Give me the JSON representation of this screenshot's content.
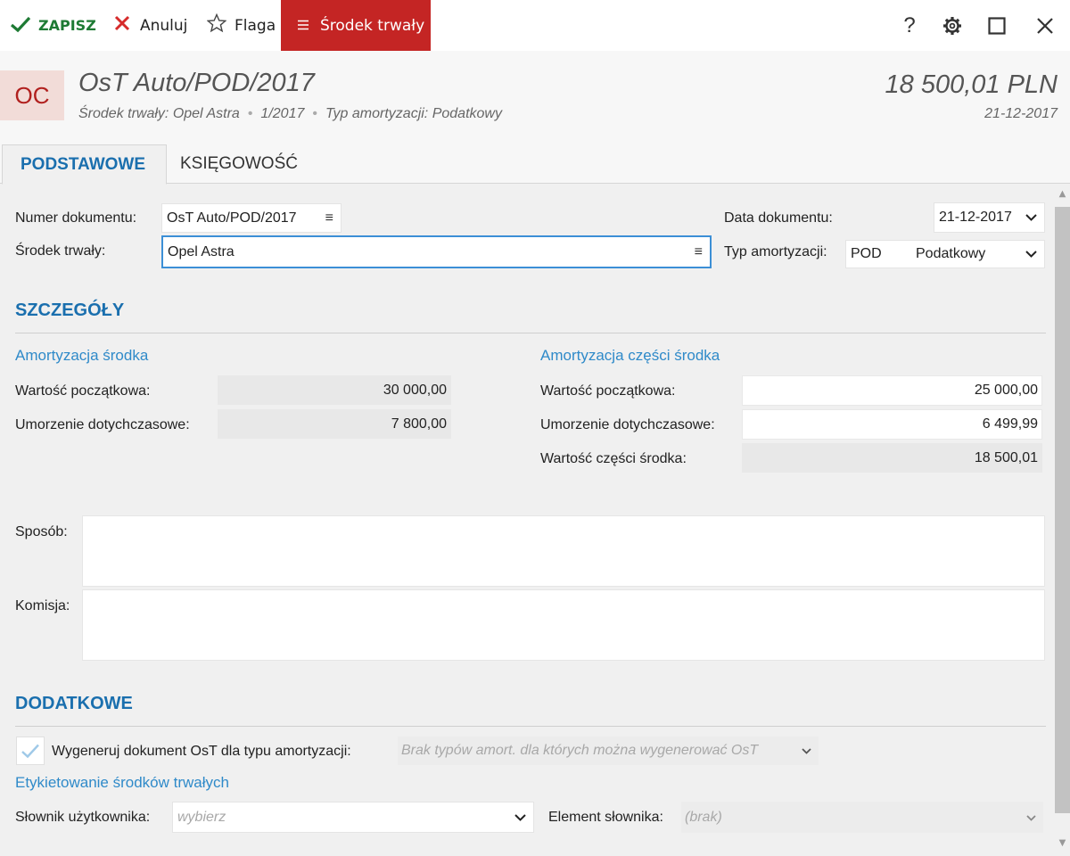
{
  "toolbar": {
    "save_label": "ZAPISZ",
    "cancel_label": "Anuluj",
    "flag_label": "Flaga",
    "asset_label": "Środek trwały",
    "help_label": "?",
    "colors": {
      "save": "#1e7a34",
      "cancel": "#d62b2b",
      "asset_bg": "#c42524"
    }
  },
  "header": {
    "badge": "OC",
    "title": "OsT Auto/POD/2017",
    "subtitle_asset": "Środek trwały: Opel Astra",
    "subtitle_number": "1/2017",
    "subtitle_type": "Typ amortyzacji: Podatkowy",
    "amount": "18 500,01 PLN",
    "date": "21-12-2017"
  },
  "tabs": [
    {
      "label": "PODSTAWOWE",
      "active": true
    },
    {
      "label": "KSIĘGOWOŚĆ",
      "active": false
    }
  ],
  "form": {
    "doc_number_label": "Numer dokumentu:",
    "doc_number_value": "OsT Auto/POD/2017",
    "asset_label": "Środek trwały:",
    "asset_value": "Opel Astra",
    "doc_date_label": "Data dokumentu:",
    "doc_date_value": "21-12-2017",
    "amort_type_label": "Typ amortyzacji:",
    "amort_type_code": "POD",
    "amort_type_name": "Podatkowy"
  },
  "details": {
    "section_title": "SZCZEGÓŁY",
    "left": {
      "heading": "Amortyzacja środka",
      "initial_label": "Wartość początkowa:",
      "initial_value": "30 000,00",
      "depr_label": "Umorzenie dotychczasowe:",
      "depr_value": "7 800,00"
    },
    "right": {
      "heading": "Amortyzacja części środka",
      "initial_label": "Wartość początkowa:",
      "initial_value": "25 000,00",
      "depr_label": "Umorzenie dotychczasowe:",
      "depr_value": "6 499,99",
      "part_label": "Wartość części środka:",
      "part_value": "18 500,01"
    },
    "method_label": "Sposób:",
    "committee_label": "Komisja:"
  },
  "extra": {
    "section_title": "DODATKOWE",
    "generate_label": "Wygeneruj dokument OsT dla typu amortyzacji:",
    "generate_placeholder": "Brak typów amort. dla których można wygenerować OsT",
    "labeling_heading": "Etykietowanie środków trwałych",
    "dictionary_label": "Słownik użytkownika:",
    "dictionary_placeholder": "wybierz",
    "element_label": "Element słownika:",
    "element_placeholder": "(brak)"
  }
}
